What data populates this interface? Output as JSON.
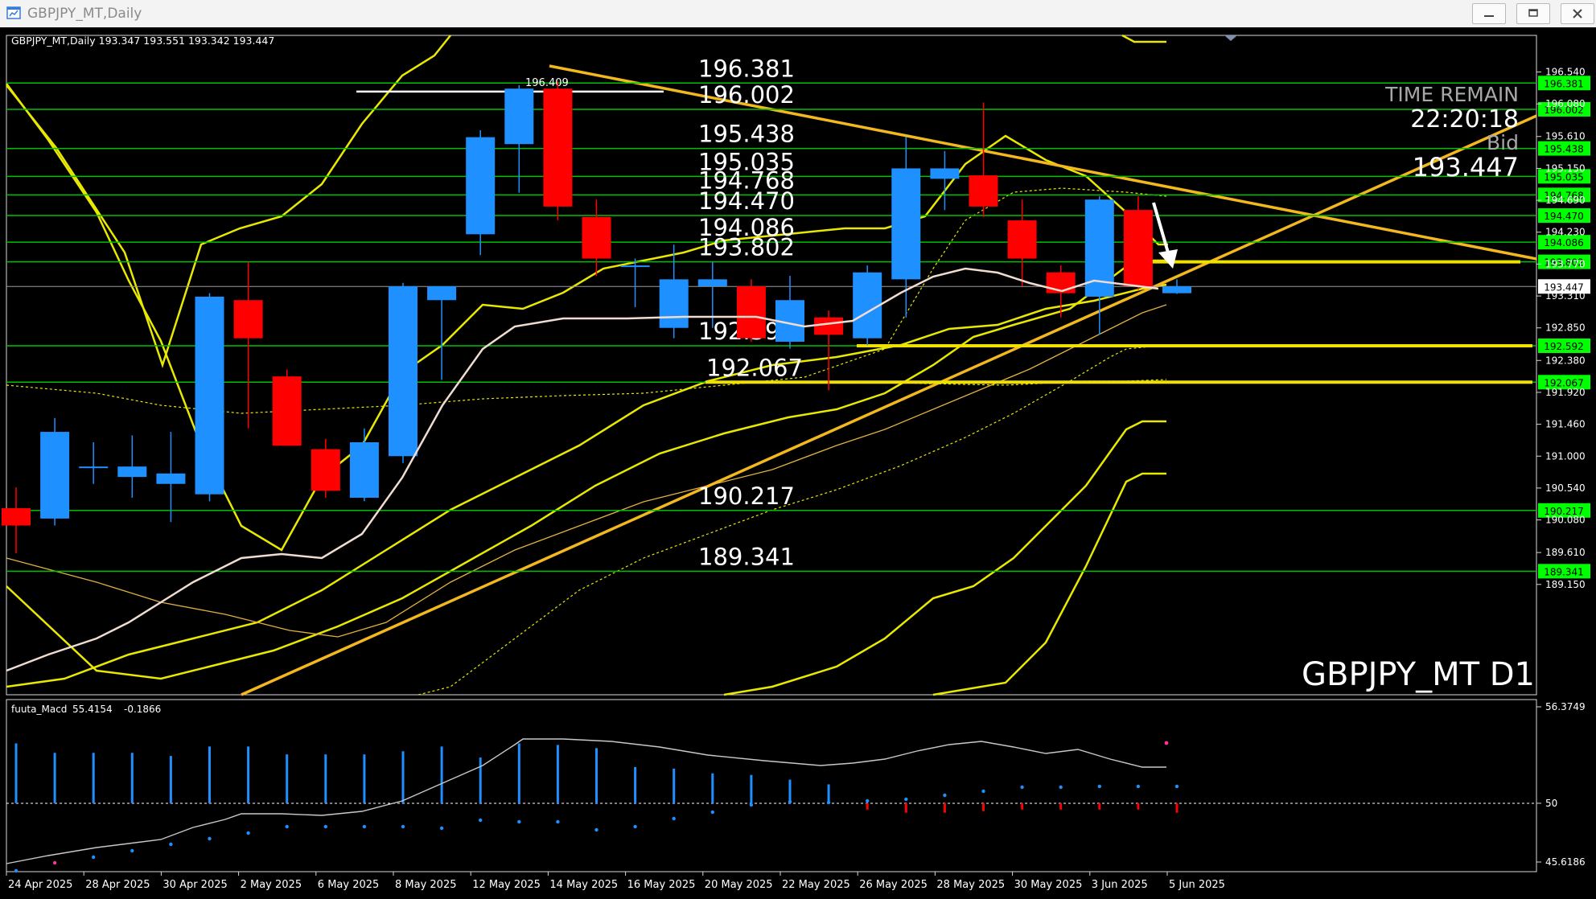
{
  "window": {
    "title": "GBPJPY_MT,Daily"
  },
  "chart_data": {
    "type": "candlestick",
    "symbol": "GBPJPY_MT",
    "timeframe": "Daily",
    "header": {
      "text": "GBPJPY_MT,Daily  193.347 193.551 193.342 193.447"
    },
    "watermark": "GBPJPY_MT D1",
    "timer": {
      "label": "TIME REMAIN",
      "value": "22:20:18",
      "bid_label": "Bid",
      "bid": "193.447"
    },
    "ylim": [
      189.15,
      196.9
    ],
    "price_ticks": [
      "196.540",
      "196.080",
      "195.610",
      "195.150",
      "194.690",
      "194.230",
      "193.770",
      "193.310",
      "192.850",
      "192.380",
      "191.920",
      "191.460",
      "191.000",
      "190.540",
      "190.080",
      "189.610",
      "189.150"
    ],
    "date_labels": [
      "24 Apr 2025",
      "28 Apr 2025",
      "30 Apr 2025",
      "2 May 2025",
      "6 May 2025",
      "8 May 2025",
      "12 May 2025",
      "14 May 2025",
      "16 May 2025",
      "20 May 2025",
      "22 May 2025",
      "26 May 2025",
      "28 May 2025",
      "30 May 2025",
      "3 Jun 2025",
      "5 Jun 2025"
    ],
    "levels": [
      {
        "value": 196.381,
        "label": "196.381",
        "tag": "196.381"
      },
      {
        "value": 196.002,
        "label": "196.002",
        "tag": "196.002"
      },
      {
        "value": 195.438,
        "label": "195.438",
        "tag": "195.438"
      },
      {
        "value": 195.035,
        "label": "195.035",
        "tag": "195.035"
      },
      {
        "value": 194.768,
        "label": "194.768",
        "tag": "194.768"
      },
      {
        "value": 194.47,
        "label": "194.470",
        "tag": "194.470"
      },
      {
        "value": 194.086,
        "label": "194.086",
        "tag": "194.086"
      },
      {
        "value": 193.802,
        "label": "193.802",
        "tag": "193.802"
      },
      {
        "value": 192.592,
        "label": "192.592",
        "tag": "192.592"
      },
      {
        "value": 192.067,
        "label": "192.067",
        "tag": "192.067"
      },
      {
        "value": 190.217,
        "label": "190.217",
        "tag": "190.217"
      },
      {
        "value": 189.341,
        "label": "189.341",
        "tag": "189.341"
      }
    ],
    "high_marker": {
      "value": 196.409,
      "label": "196.409"
    },
    "current_price": {
      "value": 193.447,
      "label": "193.447"
    },
    "candles": [
      {
        "o": 190.25,
        "h": 190.55,
        "l": 189.6,
        "c": 190.0
      },
      {
        "o": 190.1,
        "h": 191.55,
        "l": 190.0,
        "c": 191.35
      },
      {
        "o": 190.85,
        "h": 191.2,
        "l": 190.6,
        "c": 190.85
      },
      {
        "o": 190.7,
        "h": 191.3,
        "l": 190.4,
        "c": 190.85
      },
      {
        "o": 190.6,
        "h": 191.35,
        "l": 190.05,
        "c": 190.75
      },
      {
        "o": 190.45,
        "h": 193.35,
        "l": 190.35,
        "c": 193.3
      },
      {
        "o": 193.25,
        "h": 193.8,
        "l": 191.4,
        "c": 192.7
      },
      {
        "o": 192.15,
        "h": 192.25,
        "l": 191.2,
        "c": 191.15
      },
      {
        "o": 191.1,
        "h": 191.25,
        "l": 190.4,
        "c": 190.5
      },
      {
        "o": 190.4,
        "h": 191.4,
        "l": 190.35,
        "c": 191.2
      },
      {
        "o": 191.0,
        "h": 193.5,
        "l": 190.9,
        "c": 193.45
      },
      {
        "o": 193.25,
        "h": 193.4,
        "l": 192.1,
        "c": 193.45
      },
      {
        "o": 194.2,
        "h": 195.7,
        "l": 193.9,
        "c": 195.6
      },
      {
        "o": 195.5,
        "h": 196.35,
        "l": 194.8,
        "c": 196.3
      },
      {
        "o": 196.3,
        "h": 196.4,
        "l": 194.4,
        "c": 194.6
      },
      {
        "o": 194.45,
        "h": 194.7,
        "l": 193.6,
        "c": 193.85
      },
      {
        "o": 193.75,
        "h": 193.85,
        "l": 193.15,
        "c": 193.75
      },
      {
        "o": 192.85,
        "h": 194.05,
        "l": 192.7,
        "c": 193.55
      },
      {
        "o": 193.45,
        "h": 193.8,
        "l": 192.85,
        "c": 193.55
      },
      {
        "o": 193.45,
        "h": 193.55,
        "l": 192.65,
        "c": 192.7
      },
      {
        "o": 192.65,
        "h": 193.6,
        "l": 192.55,
        "c": 193.25
      },
      {
        "o": 193.0,
        "h": 193.1,
        "l": 191.95,
        "c": 192.75
      },
      {
        "o": 192.7,
        "h": 193.75,
        "l": 192.6,
        "c": 193.65
      },
      {
        "o": 193.55,
        "h": 195.6,
        "l": 193.0,
        "c": 195.15
      },
      {
        "o": 195.0,
        "h": 195.4,
        "l": 194.55,
        "c": 195.15
      },
      {
        "o": 195.05,
        "h": 196.1,
        "l": 194.45,
        "c": 194.6
      },
      {
        "o": 194.4,
        "h": 194.7,
        "l": 193.45,
        "c": 193.85
      },
      {
        "o": 193.65,
        "h": 193.75,
        "l": 193.0,
        "c": 193.35
      },
      {
        "o": 193.3,
        "h": 194.75,
        "l": 192.75,
        "c": 194.7
      },
      {
        "o": 194.55,
        "h": 194.75,
        "l": 193.4,
        "c": 193.45
      },
      {
        "o": 193.35,
        "h": 193.55,
        "l": 193.34,
        "c": 193.45
      }
    ],
    "macd": {
      "label": "fuuta_Macd",
      "value": "55.4154",
      "signal": "-0.1866",
      "ticks": [
        "56.3749",
        "50",
        "45.6186"
      ],
      "ylim": [
        45.6186,
        56.3749
      ]
    }
  },
  "colors": {
    "background": "#000000",
    "bull": "#1e90ff",
    "bear": "#ff0000",
    "level_line": "#00c000",
    "trend_line": "#f2b81e",
    "band": "#e8e800",
    "white_ma": "#f0dcd0",
    "tag_text": "#000000"
  }
}
